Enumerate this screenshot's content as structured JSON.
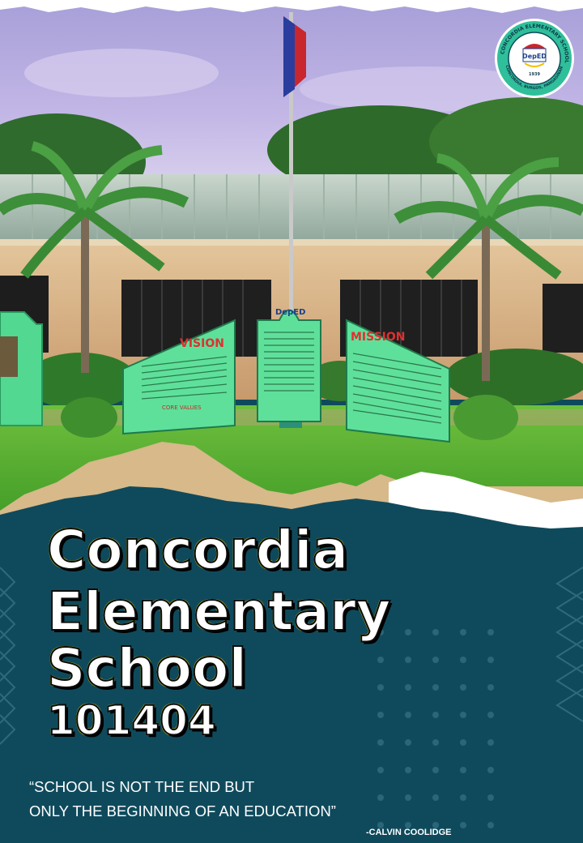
{
  "poster": {
    "title_lines": [
      "Concordia",
      "Elementary",
      "School"
    ],
    "school_id": "101404",
    "quote_line_1": "“SCHOOL IS NOT THE END BUT",
    "quote_line_2": "ONLY THE BEGINNING OF AN EDUCATION”",
    "quote_author": "-CALVIN COOLIDGE"
  },
  "photo": {
    "left_panel_heading": "VISION",
    "center_panel_heading": "DepED",
    "right_panel_heading": "MISSION",
    "core_values_label": "CORE VALUES"
  },
  "logo": {
    "ring_text": "CONCORDIA ELEMENTARY SCHOOL",
    "ring_subtext": "CONCORDIA, BURGOS, PANGASINAN",
    "center_text": "DepED",
    "year_text": "1939"
  },
  "colors": {
    "navy_band": "#0f4a5c",
    "title_outline": "#f2d600",
    "panel_green": "#5fe09a",
    "sky": "#8f8fc8"
  }
}
